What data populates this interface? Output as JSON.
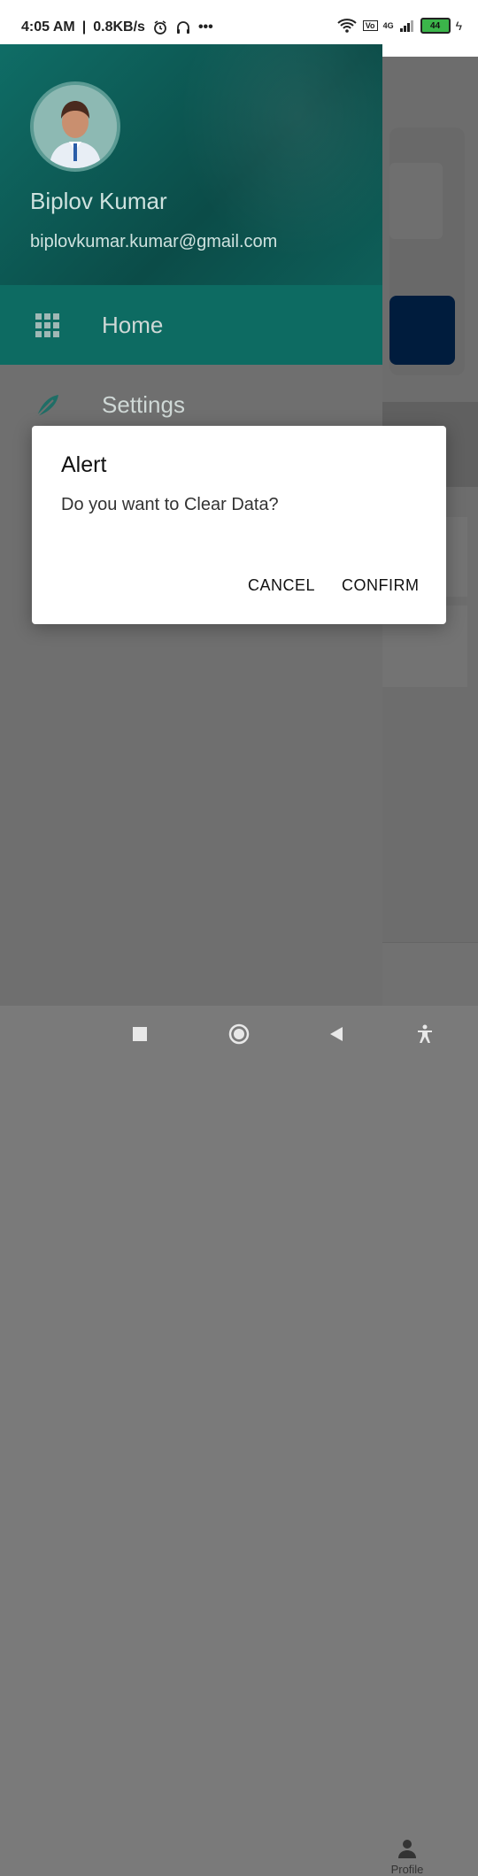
{
  "status_bar": {
    "time": "4:05 AM",
    "speed": "0.8KB/s",
    "battery": "44",
    "network": "4G"
  },
  "drawer": {
    "user": {
      "name": "Biplov Kumar",
      "email": "biplovkumar.kumar@gmail.com"
    },
    "items": [
      {
        "label": "Home",
        "icon": "grid-icon",
        "active": true
      },
      {
        "label": "Settings",
        "icon": "feather-icon",
        "active": false
      }
    ]
  },
  "background": {
    "profile_tab_label": "Profile"
  },
  "dialog": {
    "title": "Alert",
    "message": "Do you want to Clear Data?",
    "cancel_label": "CANCEL",
    "confirm_label": "CONFIRM"
  },
  "colors": {
    "drawer_header": "#0f6d66",
    "active_item": "#0d6b62",
    "accent_button": "#003f88"
  }
}
